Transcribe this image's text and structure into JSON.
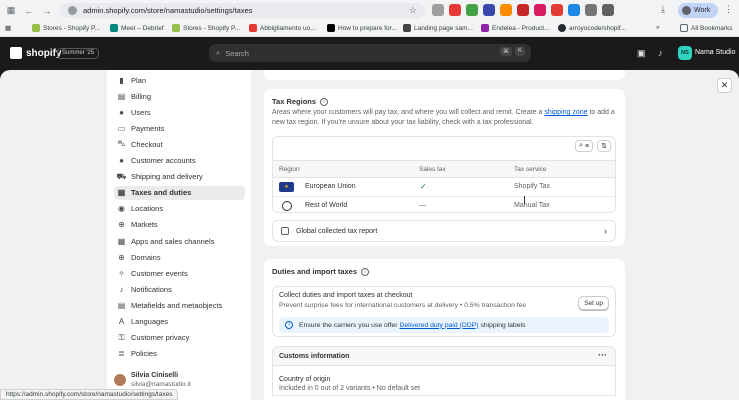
{
  "browser": {
    "url": "admin.shopify.com/store/namastudio/settings/taxes",
    "profile": "Work",
    "all_bookmarks": "All Bookmarks",
    "bookmarks": [
      {
        "label": "Stores - Shopify P...",
        "color": "#95bf47"
      },
      {
        "label": "Meet – Debrief",
        "color": "#00897b"
      },
      {
        "label": "Stores - Shopify P...",
        "color": "#95bf47"
      },
      {
        "label": "Abbigliamento uo...",
        "color": "#e53935"
      },
      {
        "label": "How to prepare for...",
        "color": "#000000"
      },
      {
        "label": "Landing page sam...",
        "color": "#444444"
      },
      {
        "label": "Endelea - Product...",
        "color": "#8e24aa"
      },
      {
        "label": "arroyocode/shopif...",
        "color": "#24292e"
      }
    ],
    "status_url": "https://admin.shopify.com/store/namastudio/settings/taxes"
  },
  "shopify": {
    "brand": "shopify",
    "edition_badge": "Summer '25",
    "search_placeholder": "Search",
    "shortcut_keys": [
      "⌘",
      "K"
    ],
    "store_initials": "NS",
    "store_name": "Nama Studio"
  },
  "sidebar": {
    "items": [
      {
        "label": "Plan",
        "icon": "plan-icon",
        "glyph": "▮"
      },
      {
        "label": "Billing",
        "icon": "billing-icon",
        "glyph": "▤"
      },
      {
        "label": "Users",
        "icon": "users-icon",
        "glyph": "●"
      },
      {
        "label": "Payments",
        "icon": "payments-icon",
        "glyph": "▭"
      },
      {
        "label": "Checkout",
        "icon": "checkout-icon",
        "glyph": "⛍"
      },
      {
        "label": "Customer accounts",
        "icon": "customer-accounts-icon",
        "glyph": "●"
      },
      {
        "label": "Shipping and delivery",
        "icon": "shipping-icon",
        "glyph": "⛟"
      },
      {
        "label": "Taxes and duties",
        "icon": "taxes-icon",
        "glyph": "▦",
        "active": true
      },
      {
        "label": "Locations",
        "icon": "locations-icon",
        "glyph": "◉"
      },
      {
        "label": "Markets",
        "icon": "markets-icon",
        "glyph": "⊕"
      },
      {
        "label": "Apps and sales channels",
        "icon": "apps-icon",
        "glyph": "▦"
      },
      {
        "label": "Domains",
        "icon": "domains-icon",
        "glyph": "⊕"
      },
      {
        "label": "Customer events",
        "icon": "customer-events-icon",
        "glyph": "✧"
      },
      {
        "label": "Notifications",
        "icon": "notifications-icon",
        "glyph": "♪"
      },
      {
        "label": "Metafields and metaobjects",
        "icon": "metafields-icon",
        "glyph": "▤"
      },
      {
        "label": "Languages",
        "icon": "languages-icon",
        "glyph": "A"
      },
      {
        "label": "Customer privacy",
        "icon": "privacy-icon",
        "glyph": "⚿"
      },
      {
        "label": "Policies",
        "icon": "policies-icon",
        "glyph": "≣"
      }
    ],
    "user_name": "Silvia Ciniselli",
    "user_email": "silvia@namastudio.it"
  },
  "tax_regions": {
    "title": "Tax Regions",
    "desc_before": "Areas where your customers will pay tax, and where you will collect and remit. Create a ",
    "desc_link": "shipping zone",
    "desc_after": " to add a new tax region. If you're unsure about your tax liability, check with a tax professional.",
    "columns": [
      "Region",
      "Sales tax",
      "Tax service"
    ],
    "rows": [
      {
        "region": "European Union",
        "sales_tax": "✓",
        "service": "Shopify Tax",
        "flag": "★"
      },
      {
        "region": "Rest of World",
        "sales_tax": "—",
        "service": "Manual Tax"
      }
    ],
    "report_label": "Global collected tax report"
  },
  "duties": {
    "title": "Duties and import taxes",
    "collect_title": "Collect duties and import taxes at checkout",
    "collect_desc": "Prevent surprise fees for international customers at delivery • 0.5% transaction fee",
    "setup_label": "Set up",
    "banner_before": "Ensure the carriers you use offer",
    "banner_link": "Delivered duty paid (DDP)",
    "banner_after": "shipping labels",
    "customs_title": "Customs information",
    "country_label": "Country of origin",
    "country_desc": "Included in 0 out of 2 variants • No default set"
  }
}
